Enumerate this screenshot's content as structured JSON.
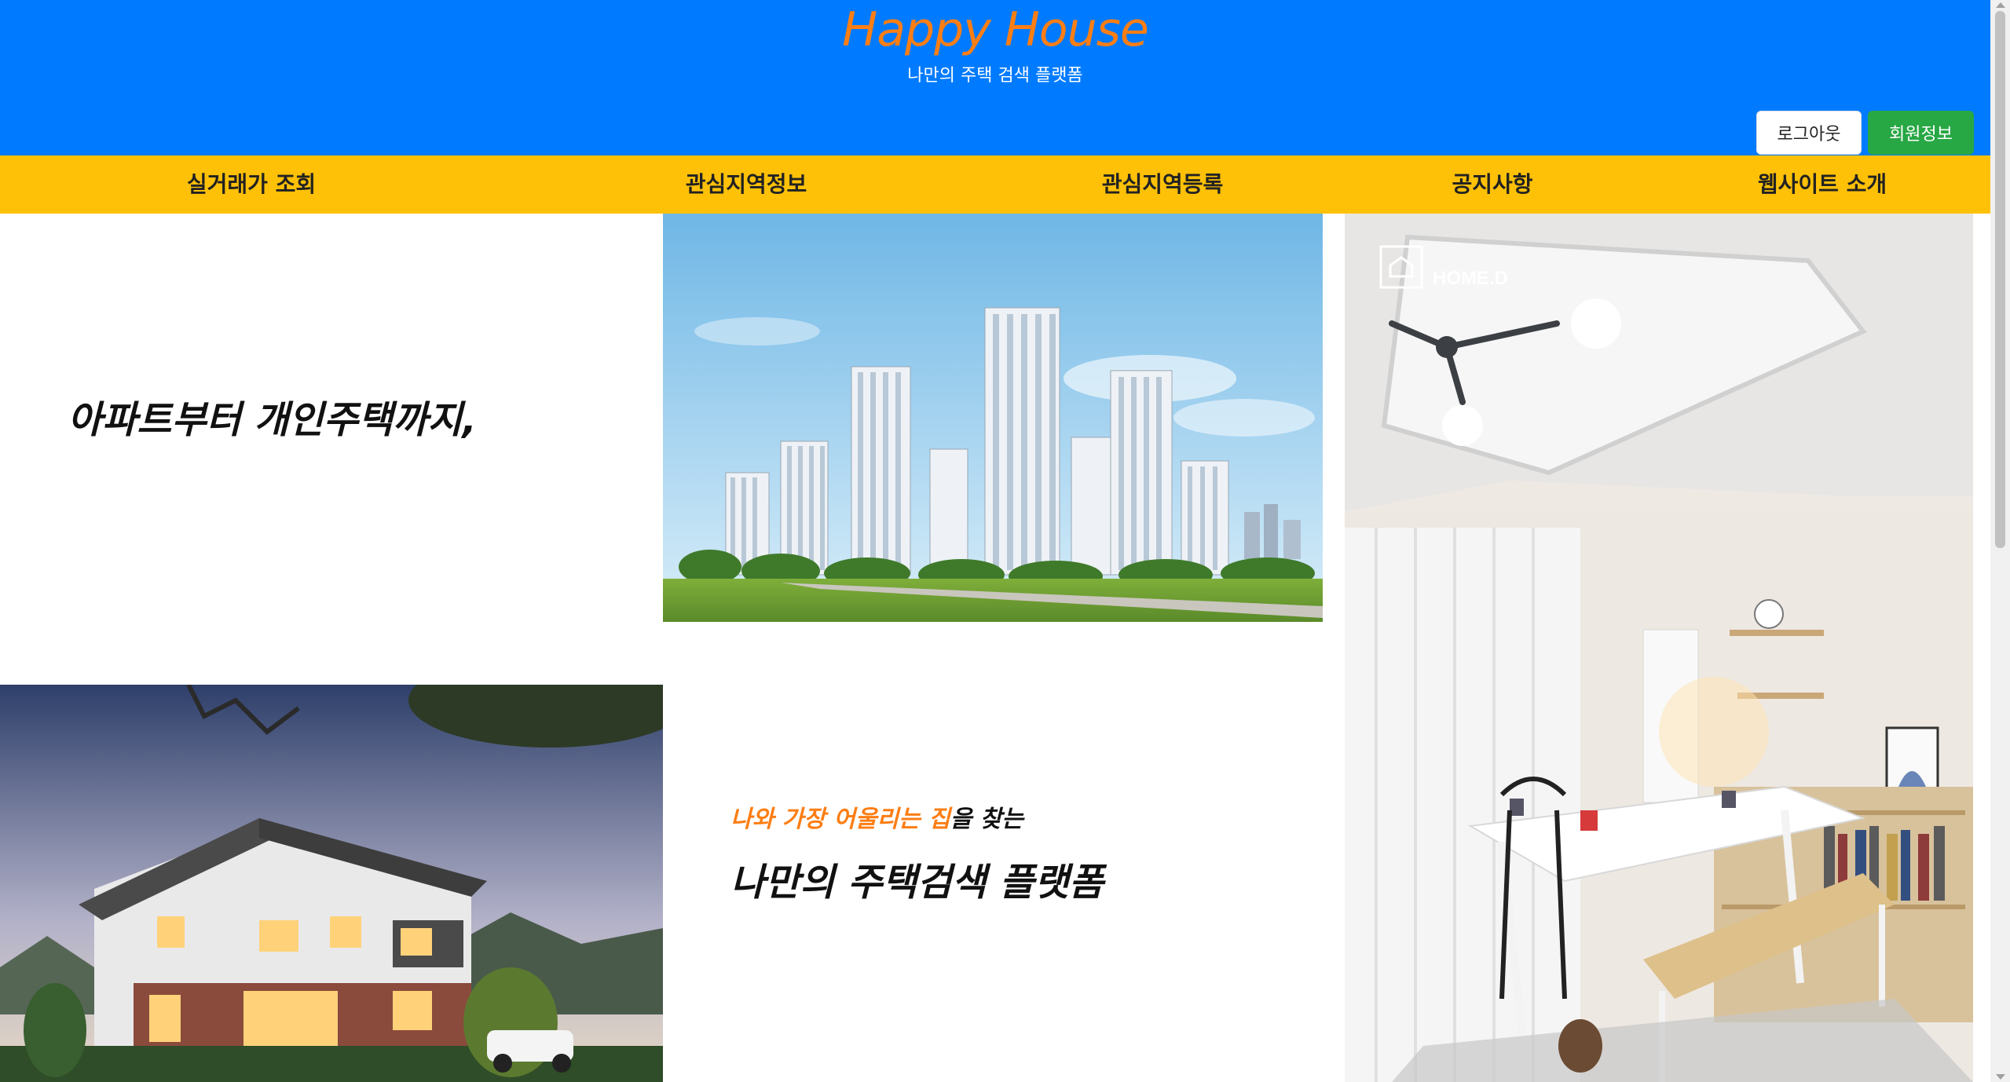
{
  "header": {
    "title": "Happy House",
    "subtitle": "나만의 주택 검색 플랫폼",
    "logout_label": "로그아웃",
    "member_label": "회원정보"
  },
  "nav": {
    "items": [
      {
        "label": "실거래가 조회"
      },
      {
        "label": "관심지역정보"
      },
      {
        "label": "관심지역등록"
      },
      {
        "label": "공지사항"
      },
      {
        "label": "웹사이트 소개"
      }
    ]
  },
  "main": {
    "hero_text": "아파트부터 개인주택까지,",
    "tagline_accent": "나와 가장 어울리는 집",
    "tagline_rest": "을 찾는",
    "tagline_big": "나만의 주택검색 플랫폼",
    "room_logo_text": "HOME.D"
  },
  "colors": {
    "header_bg": "#007bff",
    "brand": "#fd7e14",
    "nav_bg": "#ffc107",
    "member_btn": "#28a745"
  }
}
